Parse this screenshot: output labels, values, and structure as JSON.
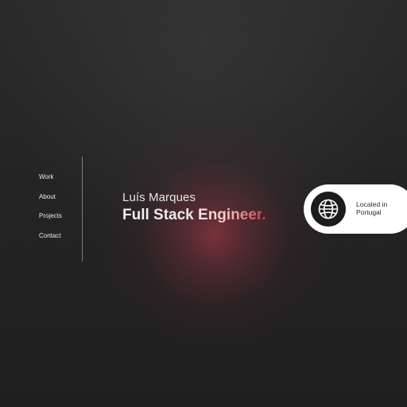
{
  "nav": {
    "items": [
      {
        "label": "Work"
      },
      {
        "label": "About"
      },
      {
        "label": "Projects"
      },
      {
        "label": "Contact"
      }
    ]
  },
  "hero": {
    "name": "Luís Marques",
    "role": "Full Stack Engineer",
    "role_suffix": "."
  },
  "location": {
    "line1": "Located in",
    "line2": "Portugal",
    "icon": "globe-icon"
  },
  "colors": {
    "background": "#232323",
    "accent": "#d83a54",
    "text": "#e6e6e6",
    "pill": "#ffffff",
    "icon_circle": "#1c1c1c"
  }
}
